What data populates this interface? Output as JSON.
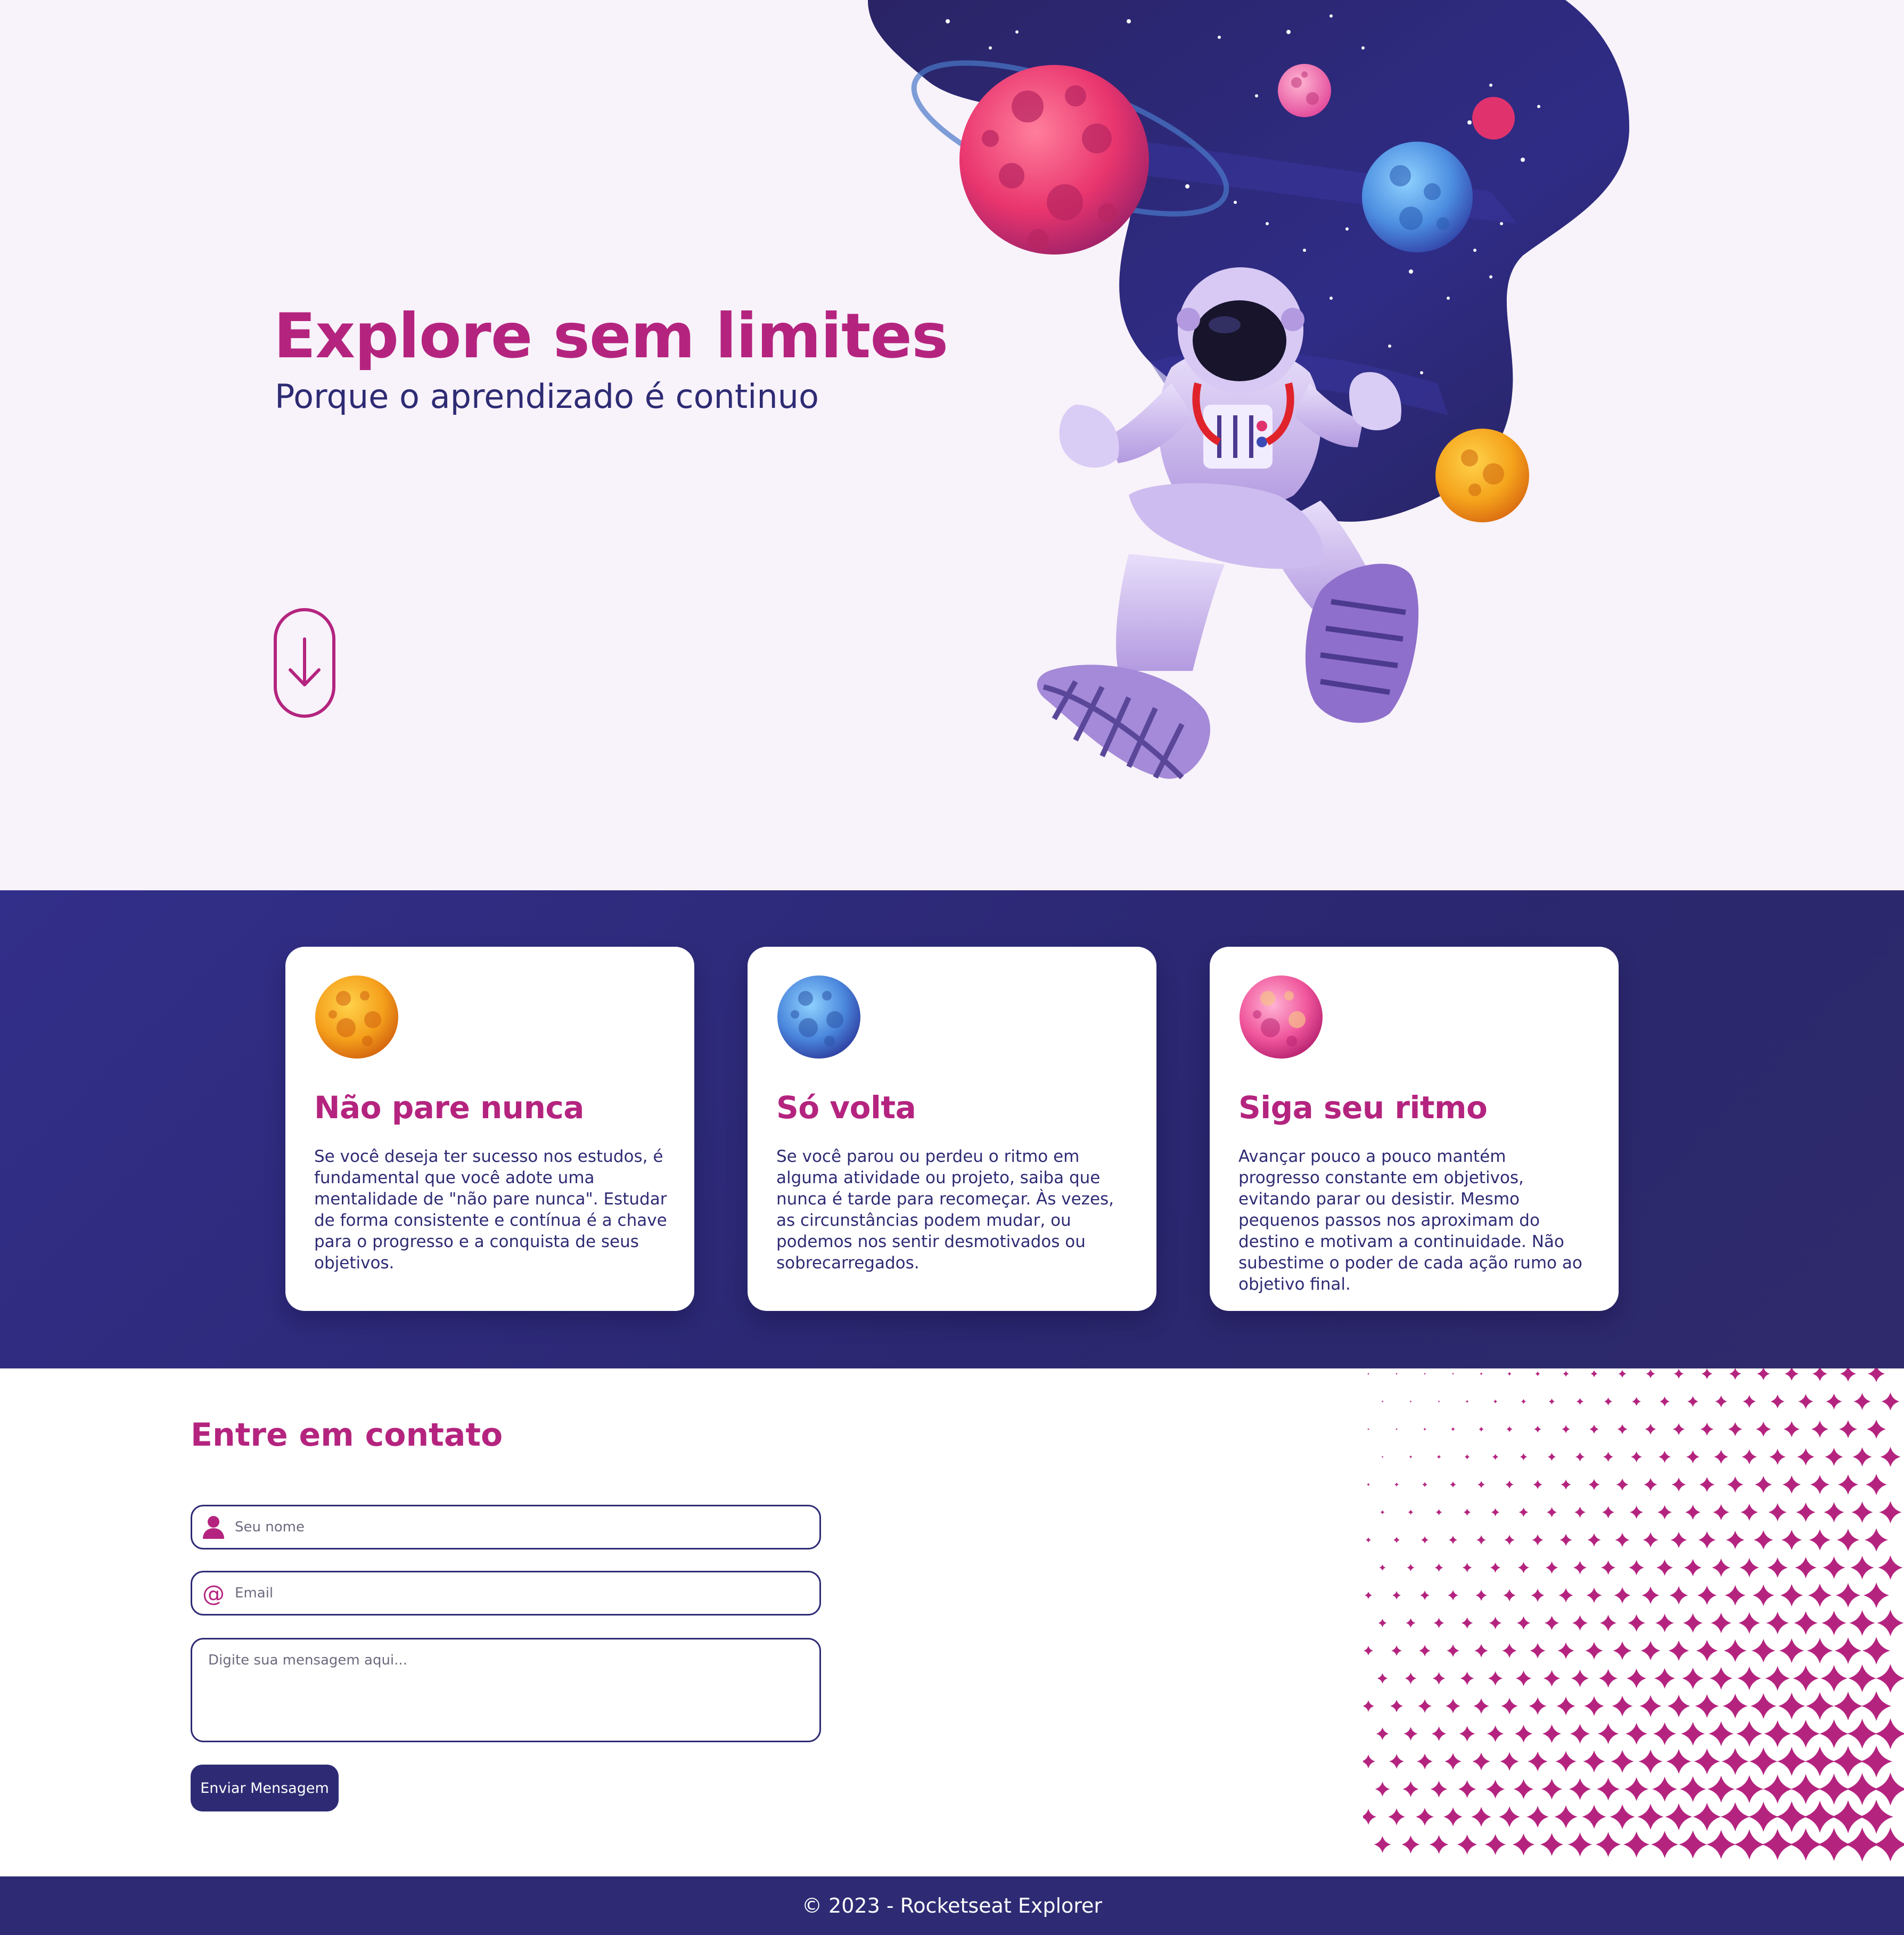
{
  "hero": {
    "title": "Explore sem limites",
    "subtitle": "Porque o aprendizado é continuo",
    "scroll_icon": "arrow-down-icon",
    "illustration": "astronaut-space-illustration"
  },
  "cards": [
    {
      "planet": "orange-planet-icon",
      "title": "Não pare nunca",
      "text": "Se você deseja ter sucesso nos estudos, é fundamental que você adote uma mentalidade de \"não pare nunca\". Estudar de forma consistente e contínua é a chave para o progresso e a conquista de seus objetivos."
    },
    {
      "planet": "blue-planet-icon",
      "title": "Só volta",
      "text": "Se você parou ou perdeu o ritmo em alguma atividade ou projeto, saiba que nunca é tarde para recomeçar. Às vezes, as circunstâncias podem mudar, ou podemos nos sentir desmotivados ou sobrecarregados."
    },
    {
      "planet": "pink-planet-icon",
      "title": "Siga seu ritmo",
      "text": "Avançar pouco a pouco mantém progresso constante em objetivos, evitando parar ou desistir. Mesmo pequenos passos nos aproximam do destino e motivam a continuidade. Não subestime o poder de cada ação rumo ao objetivo final."
    }
  ],
  "contact": {
    "title": "Entre em contato",
    "name_placeholder": "Seu nome",
    "email_placeholder": "Email",
    "message_placeholder": "Digite sua mensagem aqui...",
    "submit_label": "Enviar Mensagem"
  },
  "footer": {
    "text": "© 2023 - Rocketseat Explorer"
  },
  "colors": {
    "accent": "#b4247f",
    "primary": "#2e2b74",
    "background": "#f8f2fa"
  }
}
